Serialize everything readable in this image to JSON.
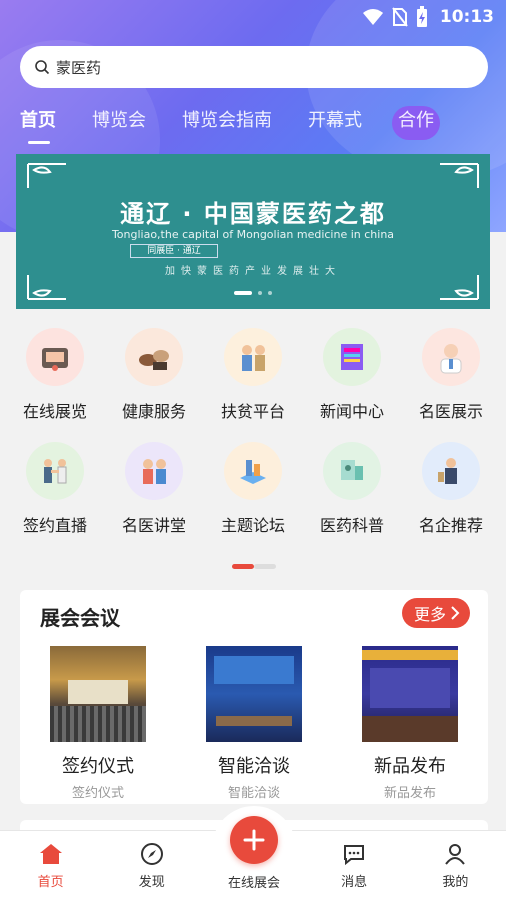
{
  "status": {
    "time": "10:13"
  },
  "search": {
    "text": "蒙医药"
  },
  "tabs": [
    {
      "label": "首页"
    },
    {
      "label": "博览会"
    },
    {
      "label": "博览会指南"
    },
    {
      "label": "开幕式"
    },
    {
      "label": "合作"
    }
  ],
  "banner": {
    "title": "通辽 · 中国蒙医药之都",
    "subtitle": "Tongliao,the capital of Mongolian medicine in china",
    "tag": "同展臣 · 通辽",
    "chars": "加快蒙医药产业发展壮大"
  },
  "grid": [
    {
      "label": "在线展览",
      "color": "#fde3df",
      "icon": "exhibition-icon"
    },
    {
      "label": "健康服务",
      "color": "#fbe8dc",
      "icon": "health-service-icon"
    },
    {
      "label": "扶贫平台",
      "color": "#fdf0dd",
      "icon": "poverty-platform-icon"
    },
    {
      "label": "新闻中心",
      "color": "#e3f3df",
      "icon": "news-icon"
    },
    {
      "label": "名医展示",
      "color": "#fde6e0",
      "icon": "doctor-icon"
    },
    {
      "label": "签约直播",
      "color": "#e4f3e0",
      "icon": "signing-icon"
    },
    {
      "label": "名医讲堂",
      "color": "#ece6fa",
      "icon": "lecture-icon"
    },
    {
      "label": "主题论坛",
      "color": "#fdefdc",
      "icon": "forum-icon"
    },
    {
      "label": "医药科普",
      "color": "#e2f3e4",
      "icon": "science-icon"
    },
    {
      "label": "名企推荐",
      "color": "#e2ecfb",
      "icon": "company-icon"
    }
  ],
  "expo": {
    "title": "展会会议",
    "more": "更多",
    "items": [
      {
        "title": "签约仪式",
        "sub": "签约仪式"
      },
      {
        "title": "智能洽谈",
        "sub": "智能洽谈"
      },
      {
        "title": "新品发布",
        "sub": "新品发布"
      }
    ]
  },
  "nav": {
    "home": "首页",
    "discover": "发现",
    "online": "在线展会",
    "messages": "消息",
    "mine": "我的"
  },
  "colors": {
    "accent": "#e84a3c",
    "banner": "#2e8f8f"
  }
}
